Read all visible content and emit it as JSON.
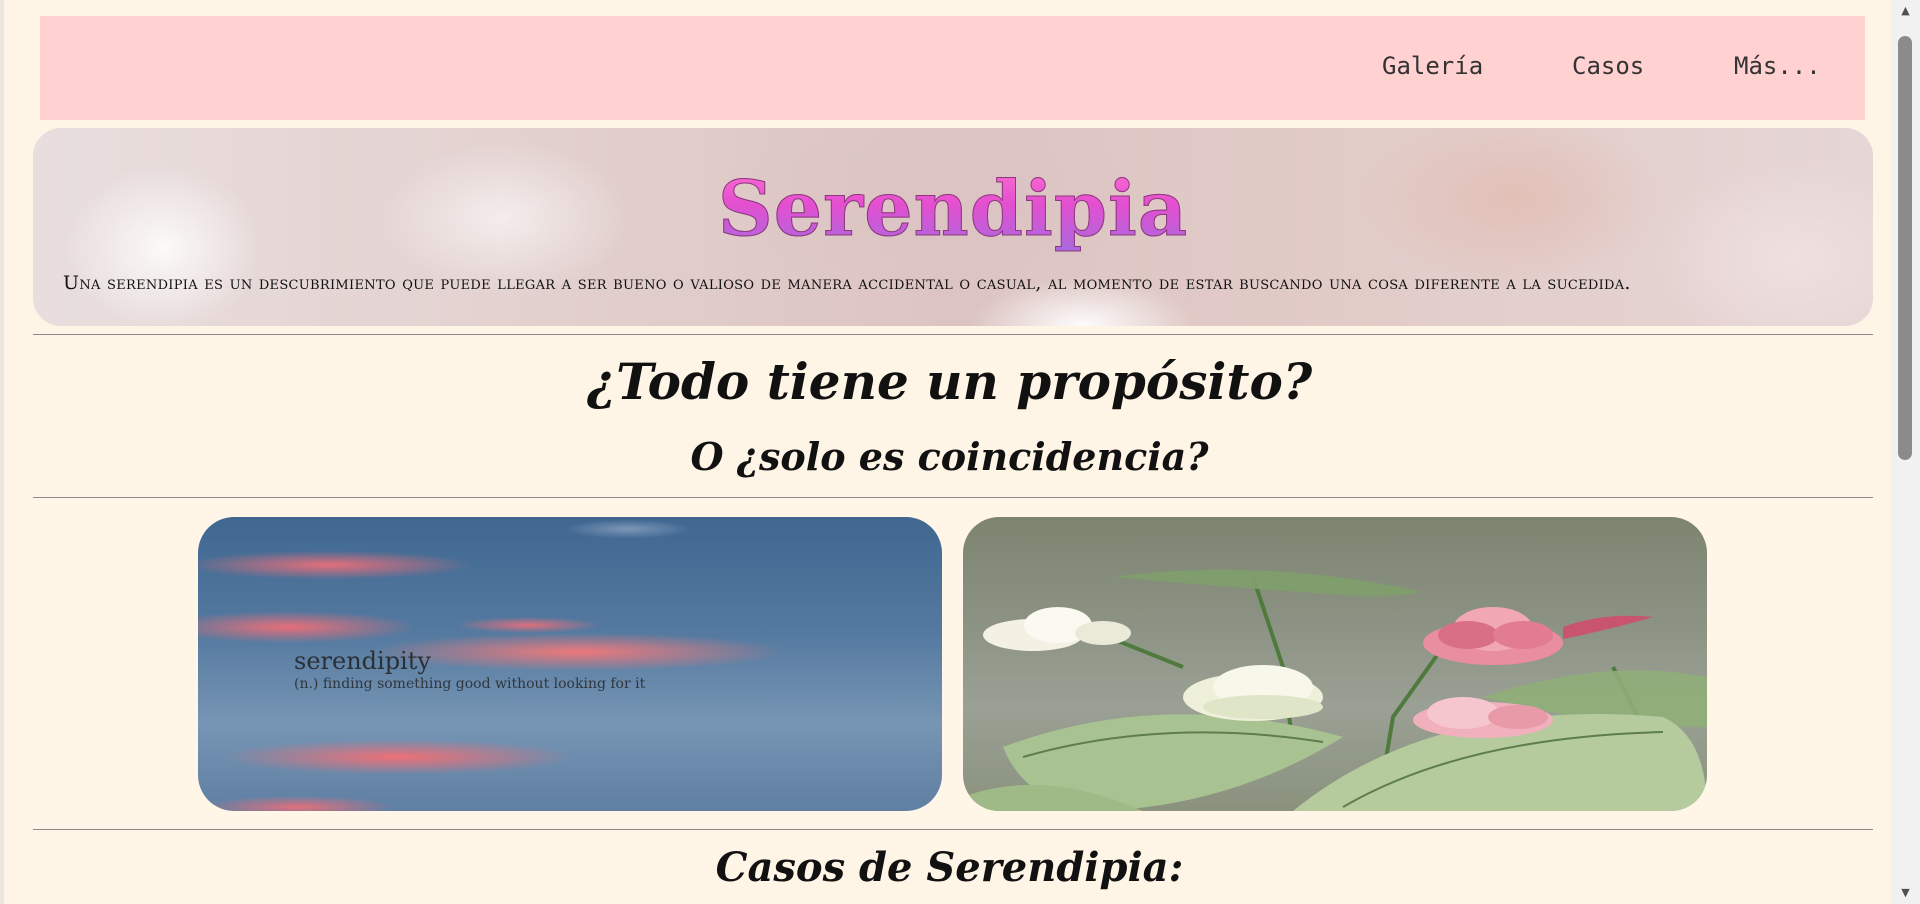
{
  "nav": {
    "links": [
      "Galería",
      "Casos",
      "Más..."
    ]
  },
  "hero": {
    "title": "Serendipia",
    "description": "Una serendipia es un descubrimiento que puede llegar a ser bueno o valioso de manera accidental o casual, al momento de estar buscando una cosa diferente a la sucedida."
  },
  "intro": {
    "heading": "¿Todo tiene un propósito?",
    "subheading": "O ¿solo es coincidencia?"
  },
  "gallery": {
    "sky_photo": {
      "word": "serendipity",
      "definition": "(n.) finding something good without looking for it"
    },
    "flower_photo": {
      "icon": "flower-photo"
    }
  },
  "cases": {
    "heading": "Casos de Serendipia:"
  },
  "colors": {
    "nav_bg": "#ffd1d1",
    "page_bg": "#fff5e6",
    "title_gradient_top": "#ff6fcf",
    "title_gradient_bottom": "#a66be0"
  }
}
